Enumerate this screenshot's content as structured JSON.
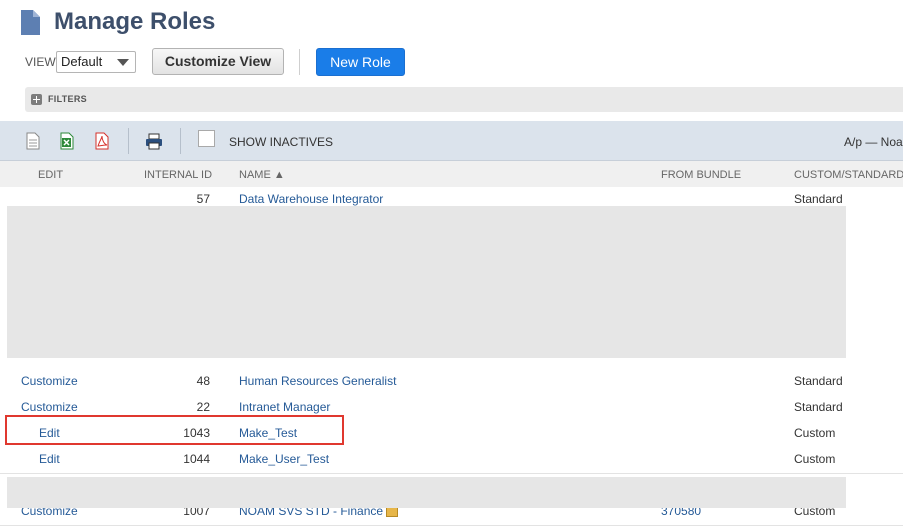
{
  "header": {
    "title": "Manage Roles",
    "view_label": "VIEW",
    "view_value": "Default",
    "customize_view_label": "Customize View",
    "new_role_label": "New Role"
  },
  "filters": {
    "label": "FILTERS"
  },
  "toolbar": {
    "show_inactives_label": "SHOW INACTIVES",
    "right_text": "A/p — Noa",
    "icons": [
      "export-document-icon",
      "export-excel-icon",
      "export-pdf-icon",
      "print-icon"
    ]
  },
  "table": {
    "columns": [
      "EDIT",
      "INTERNAL ID",
      "NAME ▲",
      "FROM BUNDLE",
      "CUSTOM/STANDARD"
    ],
    "rows": [
      {
        "edit": "",
        "id": "57",
        "name": "Data Warehouse Integrator",
        "bundle": "",
        "type": "Standard"
      },
      {
        "edit": "Customize",
        "id": "48",
        "name": "Human Resources Generalist",
        "bundle": "",
        "type": "Standard"
      },
      {
        "edit": "Customize",
        "id": "22",
        "name": "Intranet Manager",
        "bundle": "",
        "type": "Standard"
      },
      {
        "edit": "Edit",
        "id": "1043",
        "name": "Make_Test",
        "bundle": "",
        "type": "Custom"
      },
      {
        "edit": "Edit",
        "id": "1044",
        "name": "Make_User_Test",
        "bundle": "",
        "type": "Custom"
      },
      {
        "edit": "Customize",
        "id": "1007",
        "name": "NOAM SVS STD - Finance",
        "bundle": "370580",
        "type": "Custom"
      }
    ]
  },
  "colors": {
    "accent": "#1a7de8",
    "link": "#255a97",
    "highlight": "#e0382f",
    "toolbar": "#dbe3ec"
  }
}
